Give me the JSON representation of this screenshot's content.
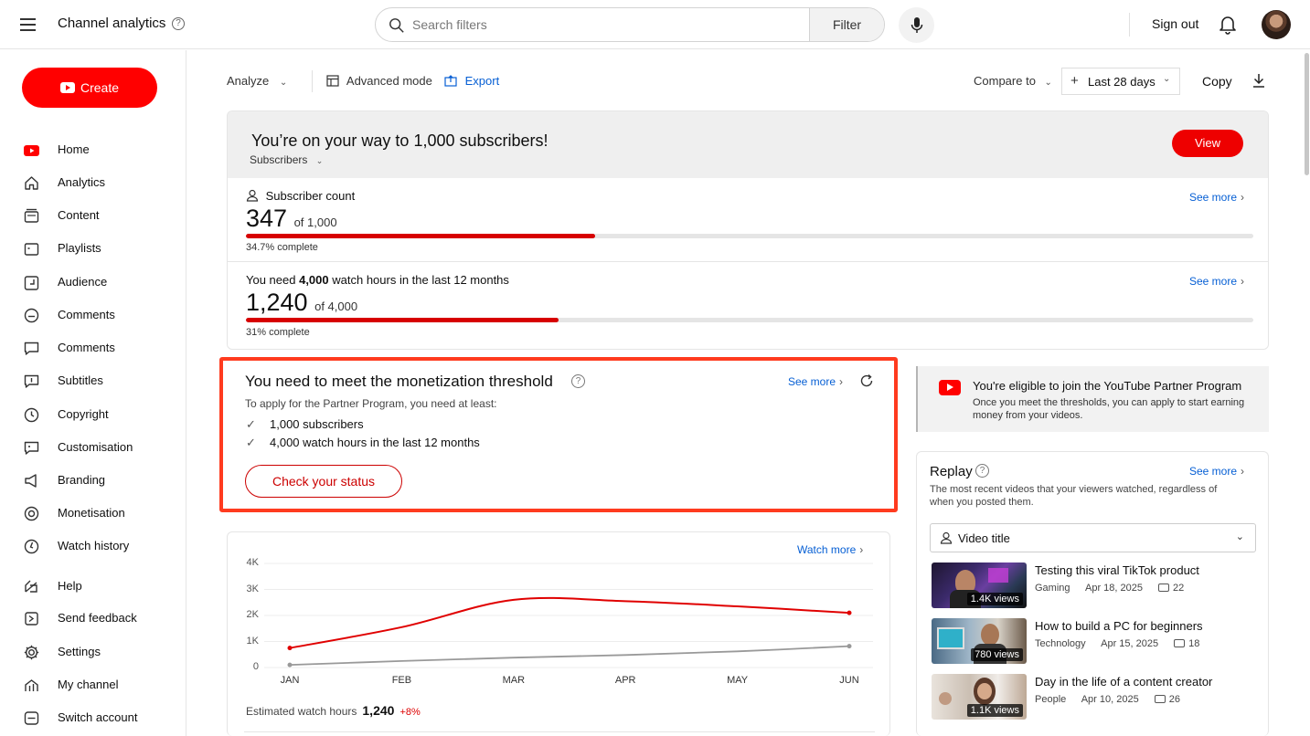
{
  "header": {
    "title": "Channel analytics",
    "help_glyph": "?",
    "search_placeholder": "Search filters",
    "filter_label": "Filter",
    "sign_out": "Sign out"
  },
  "sidebar": {
    "create_label": "Create",
    "items": [
      {
        "label": "Home",
        "icon": "youtube-icon"
      },
      {
        "label": "Analytics",
        "icon": "home-icon"
      },
      {
        "label": "Content",
        "icon": "content-icon"
      },
      {
        "label": "Playlists",
        "icon": "playlist-icon"
      },
      {
        "label": "Audience",
        "icon": "audience-icon"
      },
      {
        "label": "Comments",
        "icon": "smile-icon"
      },
      {
        "label": "Comments",
        "icon": "comment-icon"
      },
      {
        "label": "Subtitles",
        "icon": "subtitles-icon"
      },
      {
        "label": "Copyright",
        "icon": "copyright-icon"
      },
      {
        "label": "Customisation",
        "icon": "customise-icon"
      },
      {
        "label": "Branding",
        "icon": "megaphone-icon"
      },
      {
        "label": "Monetisation",
        "icon": "monetise-icon"
      },
      {
        "label": "Watch history",
        "icon": "history-icon"
      },
      {
        "label": "Help",
        "icon": "help-icon"
      },
      {
        "label": "Send feedback",
        "icon": "feedback-icon"
      },
      {
        "label": "Settings",
        "icon": "settings-icon"
      },
      {
        "label": "My channel",
        "icon": "channel-icon"
      },
      {
        "label": "Switch account",
        "icon": "switch-account-icon"
      }
    ]
  },
  "toolbar": {
    "analyze": "Analyze",
    "advanced_mode": "Advanced mode",
    "export": "Export",
    "compare_to": "Compare to",
    "date_range": "Last 28 days",
    "copy": "Copy"
  },
  "milestone": {
    "title": "You’re on your way to 1,000 subscribers!",
    "subtitle": "Subscribers",
    "view_label": "View",
    "subscribers": {
      "label": "Subscriber count",
      "value": "347",
      "of": "of 1,000",
      "progress": 0.347,
      "pct_text": "34.7% complete",
      "see_more": "See more"
    },
    "watch_hours": {
      "label_prefix": "You need ",
      "label_bold": "4,000",
      "label_suffix": " watch hours in the last 12 months",
      "value": "1,240",
      "of": "of 4,000",
      "progress": 0.31,
      "pct_text": "31% complete",
      "see_more": "See more"
    }
  },
  "monetization": {
    "title": "You need to meet the monetization threshold",
    "see_more": "See more",
    "description": "To apply for the Partner Program, you need at least:",
    "requirements": [
      "1,000 subscribers",
      "4,000 watch hours in the last 12 months"
    ],
    "check_button": "Check your status"
  },
  "ypp": {
    "title": "You're eligible to join the YouTube Partner Program",
    "text": "Once you meet the thresholds, you can apply to start earning money from your videos."
  },
  "replay": {
    "title": "Replay",
    "see_more": "See more",
    "description": "The most recent videos that your viewers watched, regardless of when you posted them.",
    "select_label": "Video title",
    "videos": [
      {
        "title": "Testing this viral TikTok product",
        "category": "Gaming",
        "date": "Apr 18, 2025",
        "comments": "22",
        "views": "1.4K views"
      },
      {
        "title": "How to build a PC for beginners",
        "category": "Technology",
        "date": "Apr 15, 2025",
        "comments": "18",
        "views": "780 views"
      },
      {
        "title": "Day in the life of a content creator",
        "category": "People",
        "date": "Apr 10, 2025",
        "comments": "26",
        "views": "1.1K views"
      }
    ]
  },
  "chart_data": {
    "type": "line",
    "watch_more": "Watch more",
    "categories": [
      "JAN",
      "FEB",
      "MAR",
      "APR",
      "MAY",
      "JUN"
    ],
    "yticks": [
      "4K",
      "3K",
      "2K",
      "1K",
      "0"
    ],
    "ylim": [
      0,
      4000
    ],
    "series": [
      {
        "color": "#e00000",
        "values": [
          750,
          1550,
          2600,
          2550,
          2350,
          2100
        ]
      },
      {
        "color": "#999999",
        "values": [
          100,
          250,
          380,
          480,
          620,
          820
        ]
      }
    ],
    "est_label": "Estimated watch hours",
    "est_value": "1,240",
    "est_delta": "+8%"
  }
}
